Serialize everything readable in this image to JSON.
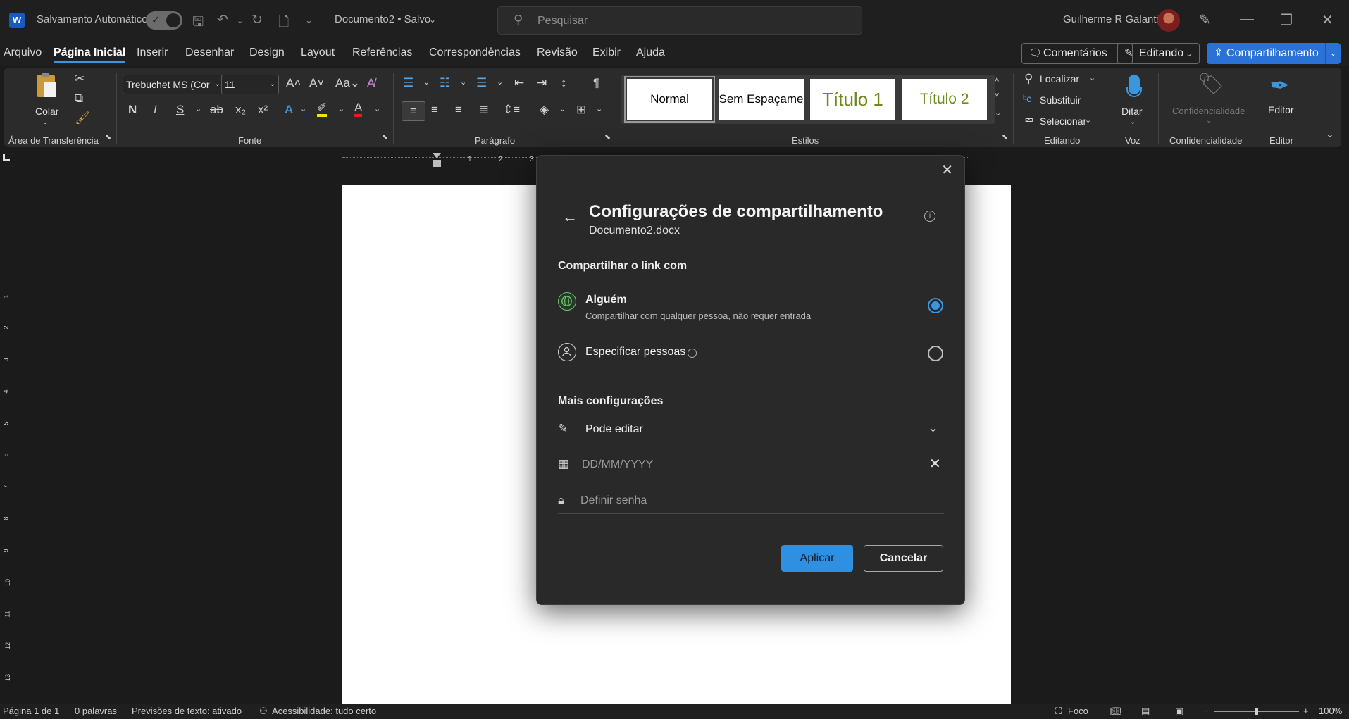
{
  "titlebar": {
    "app_icon": "W",
    "autosave_label": "Salvamento Automático",
    "autosave_state": "on",
    "doc_title": "Documento2 • Salvo",
    "search_placeholder": "Pesquisar",
    "user_name": "Guilherme R Galanti"
  },
  "menu": {
    "tabs": [
      "Arquivo",
      "Página Inicial",
      "Inserir",
      "Desenhar",
      "Design",
      "Layout",
      "Referências",
      "Correspondências",
      "Revisão",
      "Exibir",
      "Ajuda"
    ],
    "active_tab": "Página Inicial",
    "comments_label": "Comentários",
    "editing_label": "Editando",
    "share_label": "Compartilhamento"
  },
  "ribbon": {
    "clipboard": {
      "paste_label": "Colar",
      "group_label": "Área de Transferência"
    },
    "font": {
      "font_name": "Trebuchet MS (Cor",
      "font_size": "11",
      "group_label": "Fonte",
      "bold": "N",
      "italic": "I",
      "underline": "S"
    },
    "paragraph": {
      "group_label": "Parágrafo"
    },
    "styles": {
      "items": [
        "Normal",
        "Sem Espaçame",
        "Título 1",
        "Título 2"
      ],
      "group_label": "Estilos"
    },
    "editing": {
      "find": "Localizar",
      "replace": "Substituir",
      "select": "Selecionar",
      "group_label": "Editando"
    },
    "voice": {
      "dictate": "Ditar",
      "group_label": "Voz"
    },
    "sensitivity": {
      "button": "Confidencialidade",
      "group_label": "Confidencialidade"
    },
    "editor": {
      "button": "Editor",
      "group_label": "Editor"
    }
  },
  "dialog": {
    "title": "Configurações de compartilhamento",
    "subtitle": "Documento2.docx",
    "share_with_label": "Compartilhar o link com",
    "option_anyone_title": "Alguém",
    "option_anyone_desc": "Compartilhar com qualquer pessoa, não requer entrada",
    "option_specific_title": "Especificar pessoas",
    "selected_option": "Alguém",
    "more_settings_label": "Mais configurações",
    "permission_value": "Pode editar",
    "date_placeholder": "DD/MM/YYYY",
    "password_placeholder": "Definir senha",
    "apply_label": "Aplicar",
    "cancel_label": "Cancelar"
  },
  "ruler": {
    "marks": [
      "1",
      "2",
      "3"
    ],
    "vertical_marks": [
      "1",
      "2",
      "3",
      "4",
      "5",
      "6",
      "7",
      "8",
      "9",
      "10",
      "11",
      "12",
      "13"
    ]
  },
  "statusbar": {
    "page": "Página 1 de 1",
    "words": "0 palavras",
    "predictions": "Previsões de texto: ativado",
    "accessibility": "Acessibilidade: tudo certo",
    "focus": "Foco",
    "zoom": "100%"
  },
  "colors": {
    "accent": "#3a96dd",
    "share_button": "#2a72d5",
    "apply_button": "#2f8fe0"
  }
}
